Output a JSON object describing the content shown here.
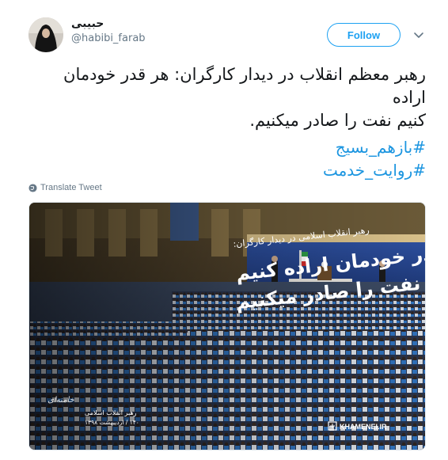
{
  "tweet": {
    "display_name": "حبیبی",
    "handle": "@habibi_farab",
    "follow_label": "Follow",
    "text_lines": [
      "رهبر معظم انقلاب در دیدار کارگران: هر قدر خودمان اراده",
      "کنیم نفت را صادر میکنیم."
    ],
    "hashtags": [
      "#بازهم_بسیج",
      "#روایت_خدمت"
    ],
    "translate_label": "Translate Tweet"
  },
  "media": {
    "caption_small": "رهبر انقلاب اسلامی در دیدار کارگران:",
    "headline_line1": "هر قدر خودمان اراده کنیم",
    "headline_line2": "نفت را صادر میکنیم",
    "footer_title": "رهبر انقلاب اسلامی",
    "footer_date": "۱۴۰ / اردیبهشت ۱۳۹۸",
    "watermark": "KHAMENEI.IR",
    "signature": "خامنه‌ای"
  },
  "colors": {
    "accent": "#1da1f2",
    "hashtag": "#1b95e0",
    "muted": "#657786"
  },
  "icons": {
    "menu": "chevron-down-icon",
    "translate": "globe-icon"
  }
}
